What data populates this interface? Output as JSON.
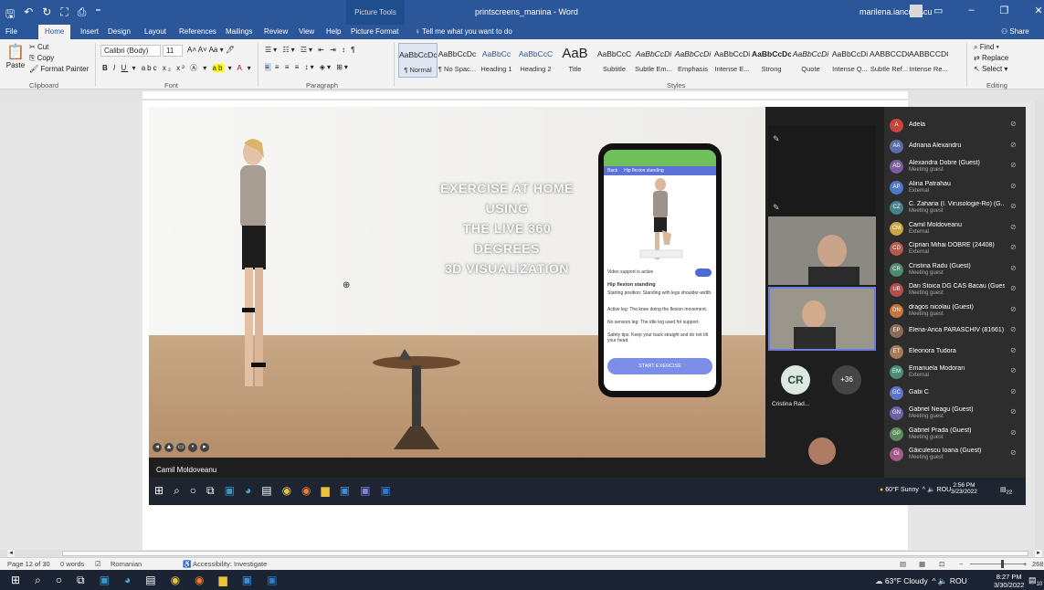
{
  "word": {
    "title_bar": {
      "document_title": "printscreens_manina - Word",
      "picture_tools": "Picture Tools",
      "user_name": "marilena.ianculescu"
    },
    "tabs": [
      "File",
      "Home",
      "Insert",
      "Design",
      "Layout",
      "References",
      "Mailings",
      "Review",
      "View",
      "Help",
      "Picture Format"
    ],
    "tell_me": "Tell me what you want to do",
    "share": "Share",
    "clipboard": {
      "cut": "Cut",
      "copy": "Copy",
      "paste": "Paste",
      "format_painter": "Format Painter",
      "label": "Clipboard"
    },
    "font": {
      "name": "Calibri (Body)",
      "size": "11",
      "label": "Font"
    },
    "paragraph_label": "Paragraph",
    "styles": {
      "label": "Styles",
      "items": [
        {
          "sample": "AaBbCcDc",
          "name": "¶ Normal"
        },
        {
          "sample": "AaBbCcDc",
          "name": "¶ No Spac..."
        },
        {
          "sample": "AaBbCc",
          "name": "Heading 1"
        },
        {
          "sample": "AaBbCcC",
          "name": "Heading 2"
        },
        {
          "sample": "AaB",
          "name": "Title"
        },
        {
          "sample": "AaBbCcC",
          "name": "Subtitle"
        },
        {
          "sample": "AaBbCcDi",
          "name": "Subtle Em..."
        },
        {
          "sample": "AaBbCcDi",
          "name": "Emphasis"
        },
        {
          "sample": "AaBbCcDi",
          "name": "Intense E..."
        },
        {
          "sample": "AaBbCcDc",
          "name": "Strong"
        },
        {
          "sample": "AaBbCcDi",
          "name": "Quote"
        },
        {
          "sample": "AaBbCcDi",
          "name": "Intense Q..."
        },
        {
          "sample": "AABBCCDC",
          "name": "Subtle Ref..."
        },
        {
          "sample": "AABBCCDC",
          "name": "Intense Re..."
        }
      ]
    },
    "editing": {
      "find": "Find",
      "replace": "Replace",
      "select": "Select",
      "label": "Editing"
    },
    "status": {
      "page": "Page 12 of 30",
      "words": "0 words",
      "language": "Romanian",
      "accessibility": "Accessibility: Investigate",
      "zoom": "268"
    }
  },
  "screenshot": {
    "banner_lines": [
      "EXERCISE AT HOME USING",
      "THE LIVE 360 DEGREES",
      "3D VISUALIZATION"
    ],
    "phone": {
      "back": "Back",
      "screen_title": "Hip flexion standing",
      "video_support": "Video support is active",
      "exercise_title": "Hip flexion standing",
      "start_position": "Starting position: Standing with legs shoulder-width.",
      "active_leg": "Active leg: The knee doing the flexion movement.",
      "sensors_leg": "No sensors leg: The idle leg used for support.",
      "safety": "Safety tips: Keep your back straight and do not tilt your head.",
      "start_button": "START EXERCISE"
    },
    "presenter": "Camil Moldoveanu",
    "tiles": {
      "initials": "CR",
      "more": "+36",
      "name": "Cristina Rad..."
    },
    "participants": [
      {
        "initials": "A",
        "name": "Adela",
        "sub": "",
        "color": "#c9463d"
      },
      {
        "initials": "AA",
        "name": "Adriana Alexandru",
        "sub": "",
        "color": "#5b6ea9"
      },
      {
        "initials": "AD",
        "name": "Alexandra Dobre (Guest)",
        "sub": "Meeting guest",
        "color": "#7a5f9c"
      },
      {
        "initials": "AP",
        "name": "Alina Patrahau",
        "sub": "External",
        "color": "#4f77c9"
      },
      {
        "initials": "CZ",
        "name": "C. Zaharia (I. Virusologie-Ro) (G...",
        "sub": "Meeting guest",
        "color": "#47818a"
      },
      {
        "initials": "CM",
        "name": "Camil Moldoveanu",
        "sub": "External",
        "color": "#caa545"
      },
      {
        "initials": "CD",
        "name": "Ciprian Mihai DOBRE (24408)",
        "sub": "External",
        "color": "#b35a4b"
      },
      {
        "initials": "CR",
        "name": "Cristina Radu (Guest)",
        "sub": "Meeting guest",
        "color": "#4d8a6e"
      },
      {
        "initials": "UB",
        "name": "Dan Stoica DG CAS Bacau (Guest)",
        "sub": "Meeting guest",
        "color": "#b84b4b"
      },
      {
        "initials": "DN",
        "name": "dragos nicolau (Guest)",
        "sub": "Meeting guest",
        "color": "#c8743b"
      },
      {
        "initials": "EP",
        "name": "Elena-Anca PARASCHIV (81661)",
        "sub": "",
        "color": "#8c6b54"
      },
      {
        "initials": "ET",
        "name": "Eleonora Tudora",
        "sub": "",
        "color": "#a77a5a"
      },
      {
        "initials": "EM",
        "name": "Emanuela Modoran",
        "sub": "External",
        "color": "#4b8b77"
      },
      {
        "initials": "GC",
        "name": "Gabi C",
        "sub": "",
        "color": "#5b73c9"
      },
      {
        "initials": "GN",
        "name": "Gabriel Neagu (Guest)",
        "sub": "Meeting guest",
        "color": "#6a61a8"
      },
      {
        "initials": "GP",
        "name": "Gabriel Prada (Guest)",
        "sub": "Meeting guest",
        "color": "#5b8a5b"
      },
      {
        "initials": "GI",
        "name": "Găiculescu Ioana (Guest)",
        "sub": "Meeting guest",
        "color": "#a35b8a"
      }
    ],
    "inner_tray": {
      "weather": "60°F Sunny",
      "lang": "ROU",
      "time": "2:56 PM",
      "date": "3/23/2022",
      "notif": "22"
    }
  },
  "os_tray": {
    "weather": "63°F Cloudy",
    "lang": "ROU",
    "time": "8:27 PM",
    "date": "3/30/2022",
    "notif": "10"
  }
}
